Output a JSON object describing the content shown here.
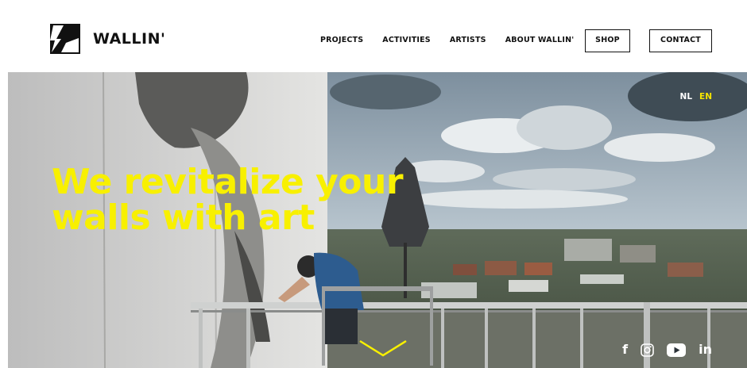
{
  "brand": {
    "name": "WALLIN'",
    "logo_icon": "wallin-logo-icon"
  },
  "nav": {
    "items": [
      {
        "label": "PROJECTS"
      },
      {
        "label": "ACTIVITIES"
      },
      {
        "label": "ARTISTS"
      },
      {
        "label": "ABOUT WALLIN'"
      }
    ],
    "shop_label": "SHOP",
    "contact_label": "CONTACT"
  },
  "language": {
    "nl": "NL",
    "en": "EN",
    "active": "EN"
  },
  "hero": {
    "headline_line1": "We revitalize your",
    "headline_line2": "walls with art",
    "scroll_icon": "chevron-down-icon"
  },
  "social": {
    "facebook": "f",
    "instagram_icon": "instagram-icon",
    "youtube_icon": "youtube-icon",
    "linkedin": "in"
  },
  "colors": {
    "accent": "#f8f000",
    "lang_active": "#f5e400",
    "text": "#111111"
  }
}
